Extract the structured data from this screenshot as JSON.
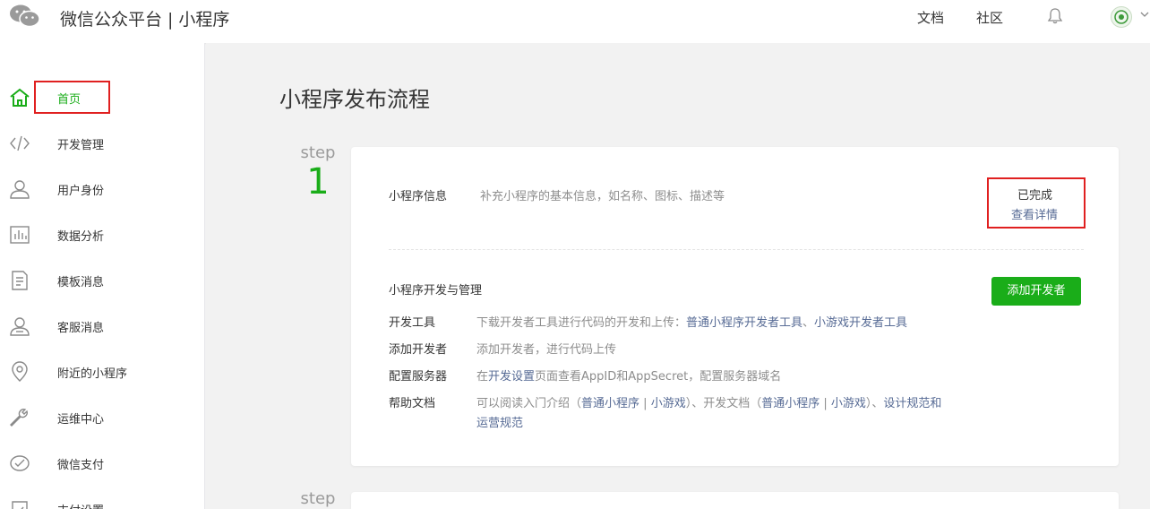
{
  "header": {
    "platform": "微信公众平台",
    "separator": "|",
    "section": "小程序",
    "links": {
      "docs": "文档",
      "community": "社区"
    }
  },
  "sidebar": {
    "items": [
      {
        "label": "首页",
        "icon": "home-icon",
        "active": true
      },
      {
        "label": "开发管理",
        "icon": "code-icon"
      },
      {
        "label": "用户身份",
        "icon": "user-icon"
      },
      {
        "label": "数据分析",
        "icon": "bar-chart-icon"
      },
      {
        "label": "模板消息",
        "icon": "document-icon"
      },
      {
        "label": "客服消息",
        "icon": "support-user-icon"
      },
      {
        "label": "附近的小程序",
        "icon": "location-pin-icon"
      },
      {
        "label": "运维中心",
        "icon": "wrench-icon"
      },
      {
        "label": "微信支付",
        "icon": "wechat-pay-icon"
      },
      {
        "label": "支付设置",
        "icon": "payment-settings-icon"
      }
    ]
  },
  "main": {
    "title": "小程序发布流程",
    "step1": {
      "step_word": "step",
      "number": "1",
      "info": {
        "label": "小程序信息",
        "desc": "补充小程序的基本信息，如名称、图标、描述等",
        "status": "已完成",
        "status_link": "查看详情"
      },
      "dev": {
        "heading": "小程序开发与管理",
        "button": "添加开发者",
        "rows": [
          {
            "label": "开发工具",
            "text1": "下载开发者工具进行代码的开发和上传：",
            "link1": "普通小程序开发者工具",
            "sep": "、",
            "link2": "小游戏开发者工具"
          },
          {
            "label": "添加开发者",
            "text1": "添加开发者，进行代码上传"
          },
          {
            "label": "配置服务器",
            "text1": "在",
            "link1": "开发设置",
            "text2": "页面查看AppID和AppSecret，配置服务器域名"
          },
          {
            "label": "帮助文档",
            "text1": "可以阅读入门介绍（",
            "link1": "普通小程序",
            "pipe1": " | ",
            "link2": "小游戏",
            "text2": "）、开发文档（",
            "link3": "普通小程序",
            "pipe2": " | ",
            "link4": "小游戏",
            "text3": "）、",
            "link5": "设计规范和",
            "link6": "运营规范"
          }
        ]
      }
    },
    "step2": {
      "step_word": "step"
    }
  },
  "colors": {
    "accent_green": "#1aad19",
    "link_blue": "#576b95",
    "highlight_red": "#e02020"
  }
}
